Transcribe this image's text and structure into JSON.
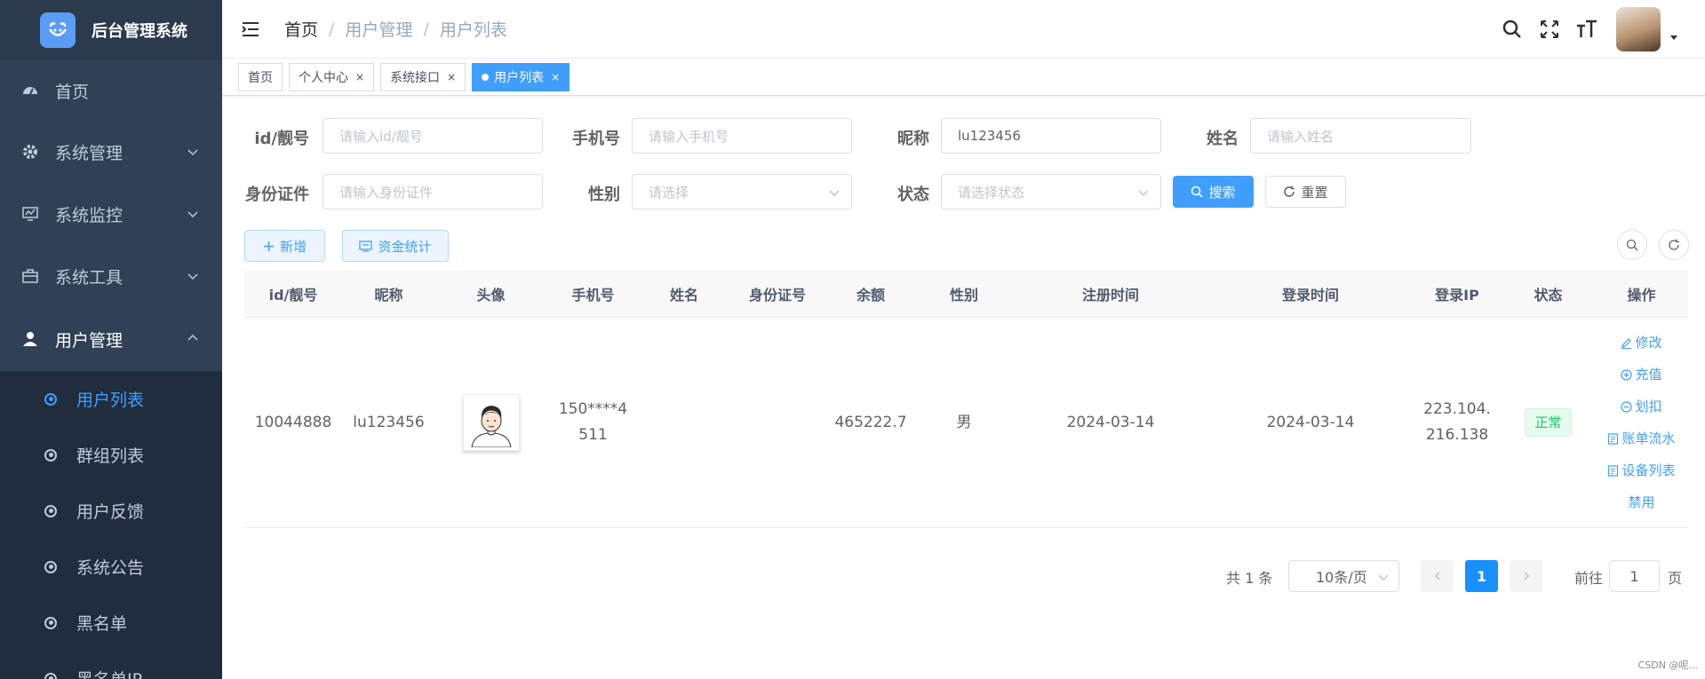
{
  "app": {
    "title": "后台管理系统"
  },
  "sidebar": {
    "items": [
      {
        "label": "首页",
        "icon": "dashboard-icon"
      },
      {
        "label": "系统管理",
        "icon": "gear-icon",
        "expandable": true
      },
      {
        "label": "系统监控",
        "icon": "monitor-icon",
        "expandable": true
      },
      {
        "label": "系统工具",
        "icon": "toolbox-icon",
        "expandable": true
      },
      {
        "label": "用户管理",
        "icon": "user-icon",
        "expandable": true,
        "open": true
      }
    ],
    "subitems": [
      {
        "label": "用户列表",
        "active": true
      },
      {
        "label": "群组列表"
      },
      {
        "label": "用户反馈"
      },
      {
        "label": "系统公告"
      },
      {
        "label": "黑名单"
      },
      {
        "label": "黑名单IP"
      }
    ]
  },
  "breadcrumb": {
    "home": "首页",
    "level1": "用户管理",
    "level2": "用户列表",
    "separator": "/"
  },
  "tags": [
    {
      "label": "首页",
      "closable": false
    },
    {
      "label": "个人中心",
      "closable": true
    },
    {
      "label": "系统接口",
      "closable": true
    },
    {
      "label": "用户列表",
      "closable": true,
      "active": true
    }
  ],
  "tag_close": "×",
  "search": {
    "id_label": "id/靓号",
    "id_placeholder": "请输入id/靓号",
    "phone_label": "手机号",
    "phone_placeholder": "请输入手机号",
    "nickname_label": "昵称",
    "nickname_value": "lu123456",
    "name_label": "姓名",
    "name_placeholder": "请输入姓名",
    "idcard_label": "身份证件",
    "idcard_placeholder": "请输入身份证件",
    "gender_label": "性别",
    "gender_placeholder": "请选择",
    "status_label": "状态",
    "status_placeholder": "请选择状态",
    "search_button": "搜索",
    "reset_button": "重置"
  },
  "toolbar": {
    "add_button": "新增",
    "stats_button": "资金统计"
  },
  "table": {
    "columns": [
      "id/靓号",
      "昵称",
      "头像",
      "手机号",
      "姓名",
      "身份证号",
      "余额",
      "性别",
      "注册时间",
      "登录时间",
      "登录IP",
      "状态",
      "操作"
    ],
    "rows": [
      {
        "id": "10044888",
        "nickname": "lu123456",
        "phone": "150****4511",
        "name": "",
        "idcard": "",
        "balance": "465222.7",
        "gender": "男",
        "register_time": "2024-03-14",
        "login_time": "2024-03-14",
        "login_ip": "223.104.216.138",
        "status": "正常",
        "actions": [
          "修改",
          "充值",
          "划扣",
          "账单流水",
          "设备列表",
          "禁用"
        ]
      }
    ]
  },
  "pagination": {
    "total": "共 1 条",
    "page_size": "10条/页",
    "current_page": "1",
    "goto_label": "前往",
    "goto_value": "1",
    "page_suffix": "页"
  },
  "watermark": "CSDN @呢...",
  "colors": {
    "primary": "#409eff",
    "sidebar_bg": "#304156",
    "submenu_bg": "#1f2d3d",
    "success": "#13ce66"
  }
}
